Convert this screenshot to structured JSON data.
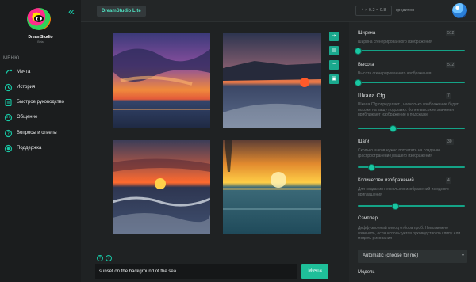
{
  "sidebar": {
    "brand": "DreamStudio",
    "brand_sub": "Beta",
    "menu_title": "МЕНЮ",
    "items": [
      {
        "label": "Мечта",
        "icon": "dream-icon"
      },
      {
        "label": "История",
        "icon": "history-icon"
      },
      {
        "label": "Быстрое руководство",
        "icon": "guide-icon"
      },
      {
        "label": "Общение",
        "icon": "community-icon"
      },
      {
        "label": "Вопросы и ответы",
        "icon": "faq-icon"
      },
      {
        "label": "Поддержка",
        "icon": "support-icon"
      }
    ]
  },
  "topbar": {
    "product": "DreamStudio Lite",
    "cost": "4 × 0.2 = 0.8",
    "credits_label": "кредитов"
  },
  "gallery": {
    "images": [
      {
        "name": "sunset-image-1",
        "description": "purple sunset over sea"
      },
      {
        "name": "sunset-image-2",
        "description": "red sun on horizon"
      },
      {
        "name": "sunset-image-3",
        "description": "orange sunset with waves"
      },
      {
        "name": "sunset-image-4",
        "description": "golden sunset over calm sea"
      }
    ],
    "tools": [
      "expand-icon",
      "download-icon",
      "delete-icon",
      "copy-icon"
    ]
  },
  "prompt": {
    "value": "sunset on the background of the sea",
    "button": "Мечта"
  },
  "settings": {
    "width": {
      "label": "Ширина",
      "value": "512",
      "desc": "Ширина сгенерированного изображения",
      "fraction": 0.0
    },
    "height": {
      "label": "Высота",
      "value": "512",
      "desc": "Высота сгенерированного изображения",
      "fraction": 0.0
    },
    "cfg": {
      "label": "Шкала Cfg",
      "value": "7",
      "desc": "Шкала Cfg определяет , насколько изображение будет похоже на вашу подсказку. более высокие значения приближают изображение к подсказке",
      "fraction": 0.33
    },
    "steps": {
      "label": "Шаги",
      "value": "30",
      "desc": "Сколько шагов нужно потратить на создание (распространение) вашего изображения",
      "fraction": 0.13
    },
    "count": {
      "label": "Количество изображений",
      "value": "4",
      "desc": "Для создания нескольких изображений из одного приглашения",
      "fraction": 0.35
    },
    "sampler": {
      "label": "Сэмплер",
      "desc": "Диффузионный метод отбора проб. Невозможно изменить, если используется руководство по клипу или модель рисования",
      "selected": "Automatic (choose for me)"
    },
    "model": {
      "label": "Модель"
    }
  }
}
